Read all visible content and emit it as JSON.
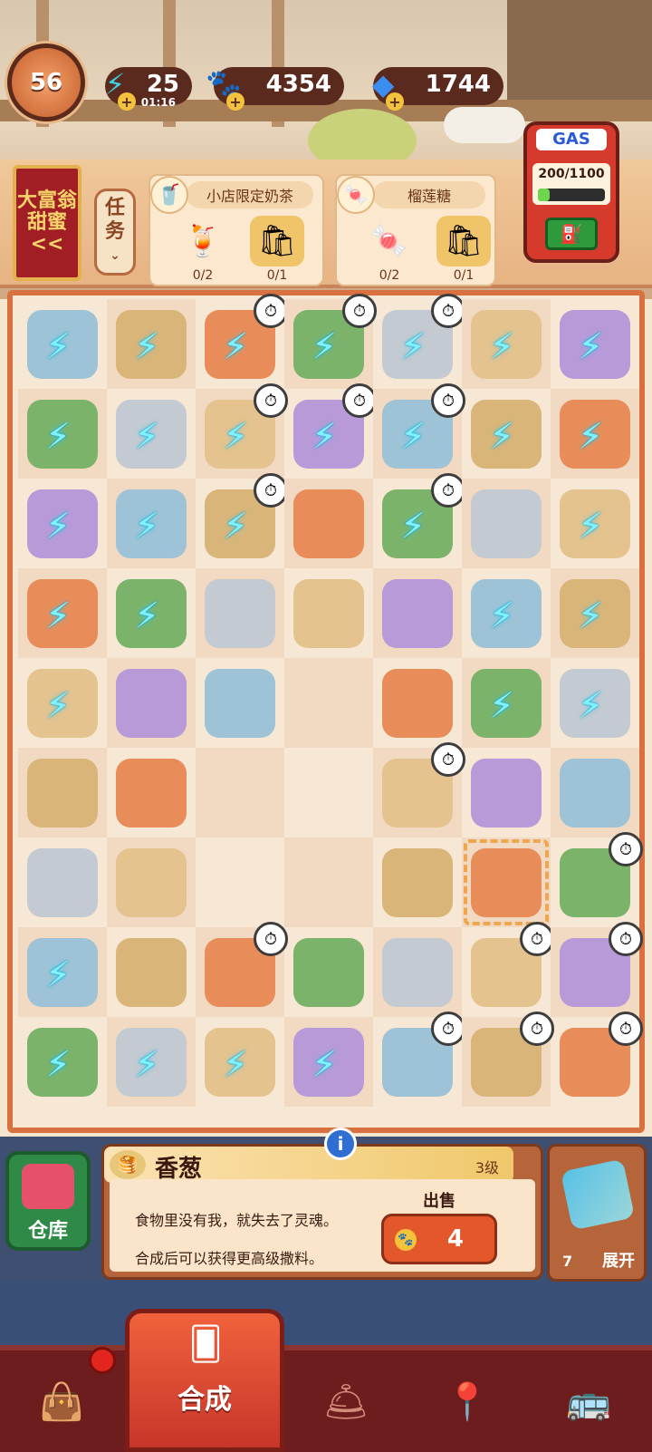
{
  "status": {
    "level": "56",
    "energy": {
      "value": "25",
      "timer": "01:16",
      "icon": "lightning-icon"
    },
    "coins": {
      "value": "4354",
      "icon": "paw-coin-icon"
    },
    "gems": {
      "value": "1744",
      "icon": "diamond-icon"
    }
  },
  "event_banner": {
    "line1": "大富翁",
    "line2": "甜蜜",
    "arrow": "<<"
  },
  "task_button": {
    "line1": "任",
    "line2": "务"
  },
  "orders": [
    {
      "title": "小店限定奶茶",
      "items": [
        {
          "icon": "milk-tea-icon",
          "count": "0/2"
        },
        {
          "icon": "gift-bag-icon",
          "count": "0/1"
        }
      ]
    },
    {
      "title": "榴莲糖",
      "items": [
        {
          "icon": "durian-candy-icon",
          "count": "0/2"
        },
        {
          "icon": "gift-bag-icon",
          "count": "0/1"
        }
      ]
    }
  ],
  "gas": {
    "label": "GAS",
    "counter": "200/1100",
    "fill": 0.18
  },
  "board": {
    "rows": [
      [
        "charged",
        "charged",
        "charged-timer",
        "charged-timer",
        "charged-timer",
        "charged",
        "charged"
      ],
      [
        "charged",
        "charged",
        "charged-timer",
        "charged-timer",
        "charged-timer",
        "charged",
        "charged"
      ],
      [
        "charged",
        "charged",
        "charged-timer",
        "item",
        "charged-timer",
        "item",
        "charged"
      ],
      [
        "charged",
        "charged",
        "item",
        "item",
        "item",
        "charged",
        "charged"
      ],
      [
        "charged",
        "item",
        "item",
        "empty",
        "item",
        "charged",
        "charged"
      ],
      [
        "item",
        "item",
        "empty",
        "empty",
        "item-timer",
        "item",
        "item"
      ],
      [
        "item",
        "item",
        "empty",
        "empty",
        "item",
        "selected",
        "item-timer"
      ],
      [
        "charged",
        "item",
        "item-timer",
        "item",
        "item",
        "item-timer",
        "item-timer"
      ],
      [
        "charged",
        "charged",
        "charged",
        "charged",
        "item-timer",
        "item-timer",
        "item-timer"
      ]
    ]
  },
  "info": {
    "name": "香葱",
    "level": "3级",
    "desc1": "食物里没有我，就失去了灵魂。",
    "desc2": "合成后可以获得更高级撒料。",
    "sell_label": "出售",
    "sell_value": "4"
  },
  "warehouse": {
    "label": "仓库"
  },
  "expand": {
    "count": "7",
    "label": "展开"
  },
  "nav": {
    "active_label": "合成"
  }
}
